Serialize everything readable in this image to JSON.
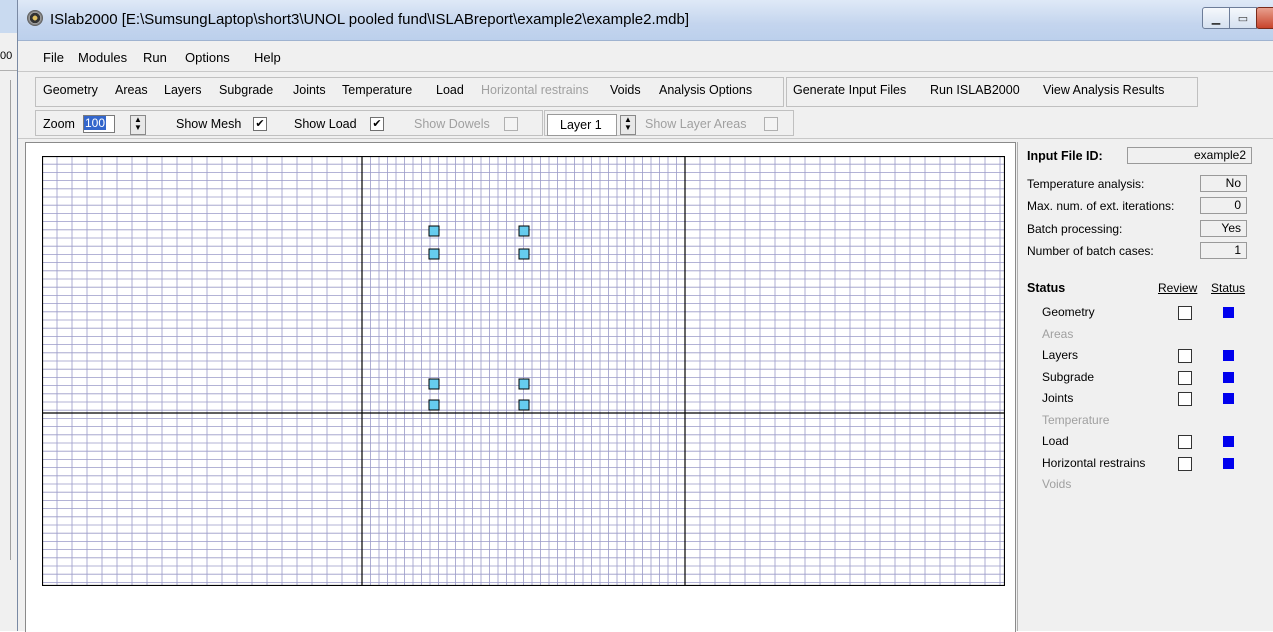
{
  "background_window": {
    "fragment": "00"
  },
  "window": {
    "title": "ISlab2000 [E:\\SumsungLaptop\\short3\\UNOL pooled fund\\ISLABreport\\example2\\example2.mdb]",
    "buttons": {
      "minimize": "▁",
      "maximize": "▭",
      "close": "✕"
    }
  },
  "menu": [
    "File",
    "Modules",
    "Run",
    "Options",
    "Help"
  ],
  "toolbar_modules": [
    "Geometry",
    "Areas",
    "Layers",
    "Subgrade",
    "Joints",
    "Temperature",
    "Load",
    "Horizontal restrains",
    "Voids",
    "Analysis Options"
  ],
  "toolbar_run": [
    "Generate Input Files",
    "Run ISLAB2000",
    "View Analysis Results"
  ],
  "viewbar": {
    "zoom_label": "Zoom",
    "zoom_value": "100",
    "show_mesh": "Show Mesh",
    "show_load": "Show Load",
    "show_dowels": "Show Dowels",
    "layer": "Layer 1",
    "show_layer_areas": "Show Layer Areas",
    "check_mark": "✔"
  },
  "panel": {
    "input_file_label": "Input File ID:",
    "input_file_value": "example2",
    "info": [
      {
        "label": "Temperature analysis:",
        "value": "No"
      },
      {
        "label": "Max. num. of ext. iterations:",
        "value": "0"
      },
      {
        "label": "Batch processing:",
        "value": "Yes"
      },
      {
        "label": "Number of batch cases:",
        "value": "1"
      }
    ],
    "status_title": "Status",
    "review_header": "Review",
    "status_header": "Status",
    "status_rows": [
      {
        "name": "Geometry",
        "enabled": true
      },
      {
        "name": "Areas",
        "enabled": false
      },
      {
        "name": "Layers",
        "enabled": true
      },
      {
        "name": "Subgrade",
        "enabled": true
      },
      {
        "name": "Joints",
        "enabled": true
      },
      {
        "name": "Temperature",
        "enabled": false
      },
      {
        "name": "Load",
        "enabled": true
      },
      {
        "name": "Horizontal restrains",
        "enabled": true
      },
      {
        "name": "Voids",
        "enabled": false
      }
    ]
  },
  "colors": {
    "mesh": "#9a9ac8",
    "joint": "#000000",
    "load": "#66ccee",
    "status": "#0000ee"
  }
}
